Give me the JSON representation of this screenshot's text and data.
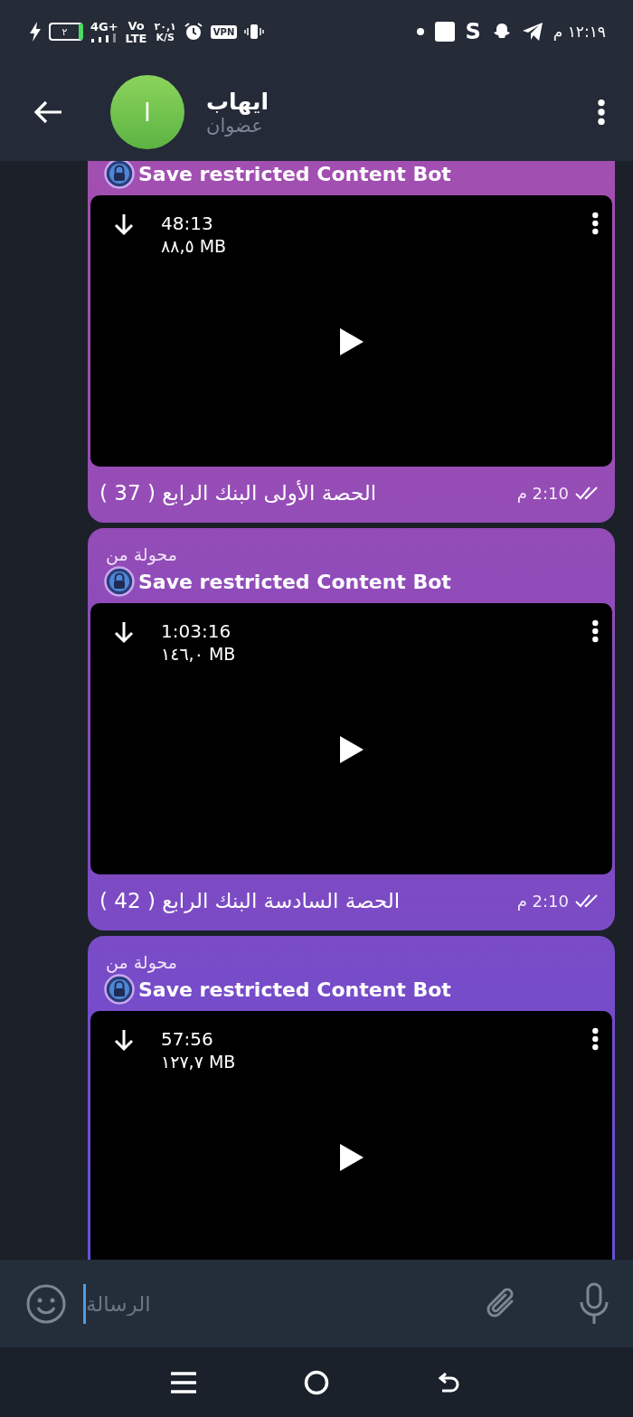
{
  "status_bar": {
    "battery": "٢",
    "network": "4G+",
    "volte_top": "Vo",
    "volte_bottom": "LTE",
    "speed_value": "٢٠,١",
    "speed_unit": "K/S",
    "vpn": "VPN",
    "app_letter": "S",
    "time": "١٢:١٩ م"
  },
  "header": {
    "avatar_letter": "ا",
    "name": "ايهاب",
    "subtitle": "عضوان"
  },
  "messages": [
    {
      "sender": "Save restricted Content Bot",
      "video": {
        "duration": "48:13",
        "size": "٨٨,٥ MB"
      },
      "caption": "الحصة الأولى البنك الرابع ( 37 )",
      "time": "2:10 م",
      "read": true
    },
    {
      "forwarded_label": "محولة من",
      "sender": "Save restricted Content Bot",
      "video": {
        "duration": "1:03:16",
        "size": "١٤٦,٠ MB"
      },
      "caption": "الحصة السادسة البنك الرابع ( 42 )",
      "time": "2:10 م",
      "read": true
    },
    {
      "forwarded_label": "محولة من",
      "sender": "Save restricted Content Bot",
      "video": {
        "duration": "57:56",
        "size": "١٢٧,٧ MB"
      }
    }
  ],
  "composer": {
    "placeholder": "الرسالة"
  }
}
